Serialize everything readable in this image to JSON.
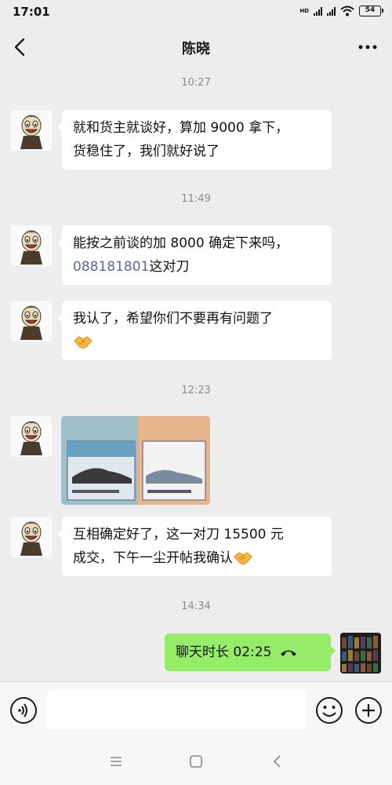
{
  "status": {
    "time": "17:01",
    "network": "HD",
    "battery": "54"
  },
  "header": {
    "title": "陈晓",
    "back_icon": "chevron-left-icon",
    "more_icon": "more-dots-icon"
  },
  "messages": [
    {
      "timestamp": "10:27",
      "lines": [
        "就和货主就谈好，算加 9000 拿下，",
        "货稳住了，我们就好说了"
      ]
    },
    {
      "timestamp": "11:49",
      "line1": "能按之前谈的加 8000 确定下来吗，",
      "link": "088181801",
      "line2_suffix": "这对刀"
    },
    {
      "line1": "我认了，希望你们不要再有问题了",
      "emoji": "handshake-emoji"
    },
    {
      "timestamp": "12:23",
      "image": "photo-message"
    },
    {
      "line1": "互相确定好了，这一对刀 15500 元",
      "line2": "成交，下午一尘开帖我确认",
      "emoji": "handshake-emoji"
    },
    {
      "timestamp": "14:34",
      "call_text": "聊天时长 02:25",
      "call_icon": "phone-hangup-icon"
    }
  ],
  "input": {
    "value": "",
    "placeholder": ""
  },
  "colors": {
    "background": "#ededed",
    "bubble_in": "#ffffff",
    "bubble_out": "#95ec69",
    "link": "#576b95",
    "timestamp": "#8a8a8a"
  }
}
